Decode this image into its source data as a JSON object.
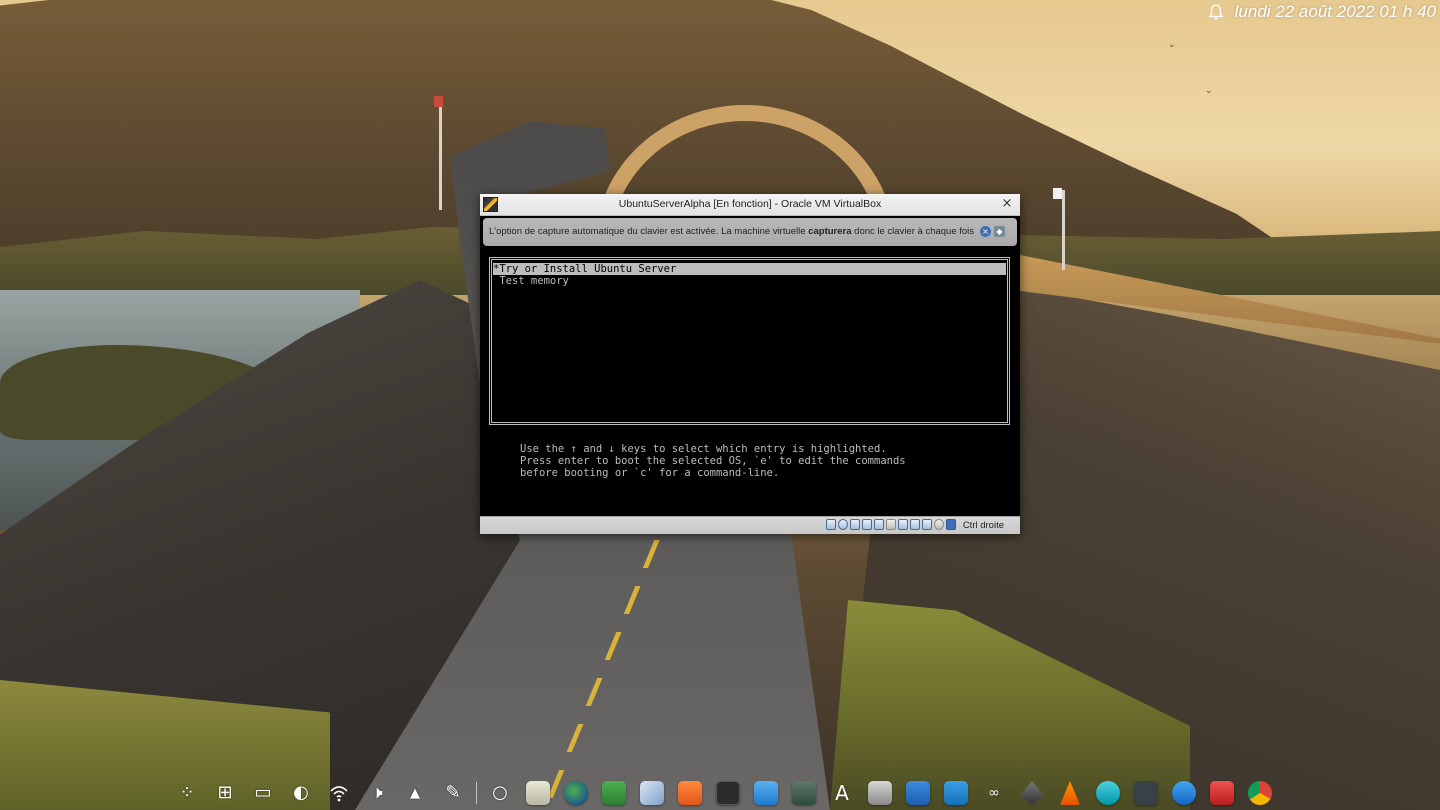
{
  "topbar": {
    "datetime": "lundi 22 août 2022  01 h 40",
    "icon": "bell-icon"
  },
  "vbox": {
    "title": "UbuntuServerAlpha [En fonction] - Oracle VM VirtualBox",
    "close_glyph": "×",
    "notice": {
      "text_before": "L'option de capture automatique du clavier est activée. La machine virtuelle ",
      "text_bold": "capturera",
      "text_after": " donc le clavier à chaque fois"
    },
    "grub": {
      "entries": [
        "*Try or Install Ubuntu Server",
        " Test memory"
      ],
      "help": "Use the ↑ and ↓ keys to select which entry is highlighted.\nPress enter to boot the selected OS, `e' to edit the commands\nbefore booting or `c' for a command-line."
    },
    "statusbar": {
      "hostkey": "Ctrl droite",
      "icons": [
        "hard-disk-icon",
        "optical-drive-icon",
        "audio-icon",
        "network-icon",
        "usb-icon",
        "shared-folders-icon",
        "display-icon",
        "video-capture-icon",
        "recording-icon",
        "mouse-integration-icon",
        "host-key-icon"
      ]
    }
  },
  "dock": {
    "items": [
      "app-menu-icon",
      "app-grid-icon",
      "desktop-icon",
      "night-mode-icon",
      "wifi-icon",
      "volume-icon",
      "tray-expand-icon",
      "color-picker-icon",
      "separator",
      "circle-icon",
      "file-manager-icon",
      "globe-icon",
      "vpn-icon",
      "virtualbox-icon",
      "sublime-icon",
      "terminal-icon",
      "screenshot-icon",
      "system-monitor-icon",
      "font-viewer-icon",
      "disks-icon",
      "home-icon",
      "writer-icon",
      "game-controller-icon",
      "inkscape-icon",
      "vlc-icon",
      "mail-icon",
      "console-icon",
      "kde-connect-icon",
      "archive-manager-icon",
      "chrome-icon"
    ]
  }
}
